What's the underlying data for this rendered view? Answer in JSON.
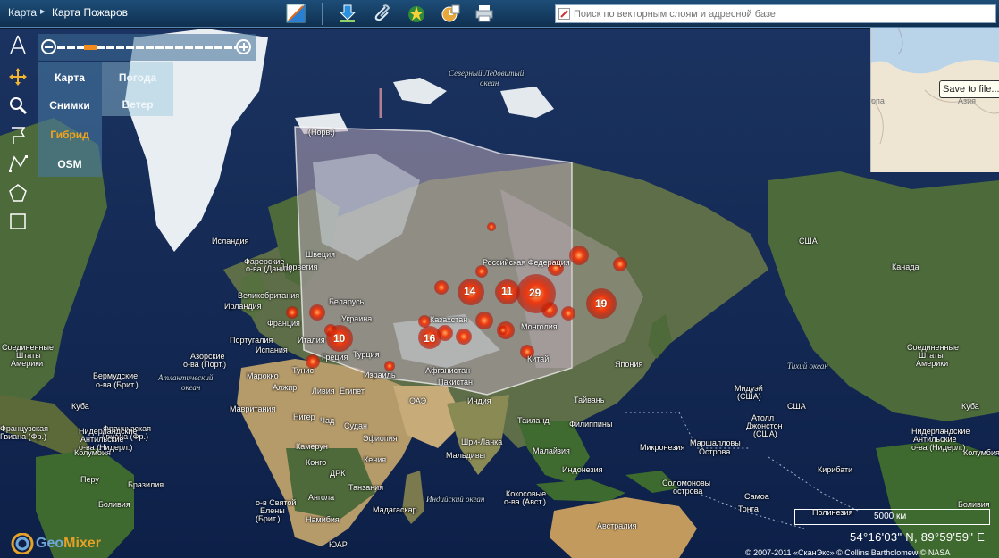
{
  "header": {
    "breadcrumb": "Карта",
    "title": "Карта Пожаров",
    "search_placeholder": "Поиск по векторным слоям и адресной базе"
  },
  "toolbar": [
    "permalink-icon",
    "download-icon",
    "attach-icon",
    "favorite-icon",
    "history-icon",
    "print-icon"
  ],
  "zoom": {
    "level_fraction": 0.17
  },
  "map_types": {
    "items": [
      "Карта",
      "Снимки",
      "Гибрид",
      "OSM"
    ],
    "selected": "Гибрид",
    "weather": [
      "Погода",
      "Ветер"
    ]
  },
  "overview": {
    "labels": [
      "Азия",
      "опа"
    ],
    "tooltip": "Save to file..."
  },
  "labels": {
    "arctic_ocean_1": "Северный Ледовитый",
    "arctic_ocean_2": "океан",
    "atlantic_1": "Атлантический",
    "atlantic_2": "океан",
    "pacific": "Тихий океан",
    "indian": "Индийский океан",
    "iceland": "Исландия",
    "faroe_1": "Фарерские",
    "faroe_2": "о-ва (Дания)",
    "svalbard": "(Норв.)",
    "sweden": "Швеция",
    "norway": "Норвегия",
    "uk": "Великобритания",
    "ireland": "Ирландия",
    "belarus": "Беларусь",
    "ukraine": "Украина",
    "france": "Франция",
    "italy": "Италия",
    "spain": "Испания",
    "portugal": "Португалия",
    "greece": "Греция",
    "turkey": "Турция",
    "tunisia": "Тунис",
    "morocco": "Марокко",
    "algeria": "Алжир",
    "libya": "Ливия",
    "egypt": "Египет",
    "israel": "Израиль",
    "mauritania": "Мавритания",
    "niger": "Нигер",
    "chad": "Чад",
    "sudan": "Судан",
    "ethiopia": "Эфиопия",
    "cameroon": "Камерун",
    "congo": "Конго",
    "drc": "ДРК",
    "kenya": "Кения",
    "tanzania": "Танзания",
    "angola": "Ангола",
    "namibia": "Намибия",
    "south_africa": "ЮАР",
    "madagascar": "Мадагаскар",
    "helena_1": "о-в Святой",
    "helena_2": "Елены",
    "helena_3": "(Брит.)",
    "azores_1": "Азорские",
    "azores_2": "о-ва (Порт.)",
    "bermuda_1": "Бермудские",
    "bermuda_2": "о-ва (Брит.)",
    "russia": "Российская Федерация",
    "kazakhstan": "Казахстан",
    "mongolia": "Монголия",
    "china": "Китай",
    "afghanistan": "Афганистан",
    "pakistan": "Пакистан",
    "uae": "ОАЭ",
    "india": "Индия",
    "thailand": "Таиланд",
    "taiwan": "Тайвань",
    "philippines": "Филиппины",
    "japan": "Япония",
    "sri_lanka": "Шри-Ланка",
    "maldives": "Мальдивы",
    "malaysia": "Малайзия",
    "indonesia": "Индонезия",
    "cocos_1": "Кокосовые",
    "cocos_2": "о-ва (Авст.)",
    "australia": "Австралия",
    "micronesia": "Микронезия",
    "marshall_1": "Маршалловы",
    "marshall_2": "Острова",
    "midway_1": "Мидуэй",
    "midway_2": "(США)",
    "atoll_1": "Атолл",
    "atoll_2": "Джонстон",
    "atoll_3": "(США)",
    "kiribati": "Кирибати",
    "solomon_1": "Соломоновы",
    "solomon_2": "острова",
    "samoa": "Самоа",
    "tonga": "Тонга",
    "polynesia": "Полинезия",
    "usa_alaska": "США",
    "usa_hawaii": "США",
    "canada": "Канада",
    "usa_1": "Соединенные",
    "usa_2": "Штаты",
    "usa_3": "Америки",
    "usa_e1": "Соединенные",
    "usa_e2": "Штаты",
    "usa_e3": "Америки",
    "cuba": "Куба",
    "cuba_e": "Куба",
    "colombia": "Колумбия",
    "colombia_e": "Колумбия",
    "peru": "Перу",
    "bolivia": "Боливия",
    "bolivia_e": "Боливия",
    "brazil": "Бразилия",
    "guiana_1": "Французская",
    "guiana_2": "Гвиана (Фр.)",
    "guiana_3": "Нидерландские",
    "guiana_4": "Антильские",
    "guiana_5": "о-ва (Нидерл.)",
    "guiana_e1": "Французская",
    "guiana_e2": "Гвиана (Фр.)",
    "guiana_e3": "Нидерландские",
    "guiana_e4": "Антильские",
    "guiana_e5": "о-ва (Нидерл.)"
  },
  "clusters": [
    "14",
    "11",
    "29",
    "19",
    "10",
    "16"
  ],
  "footer": {
    "scale": "5000 км",
    "coordinates": "54°16'03\" N, 89°59'59\" E",
    "copyright": "© 2007-2011 «СканЭкс» © Collins Bartholomew © NASA",
    "logo": "GeoMixer"
  }
}
